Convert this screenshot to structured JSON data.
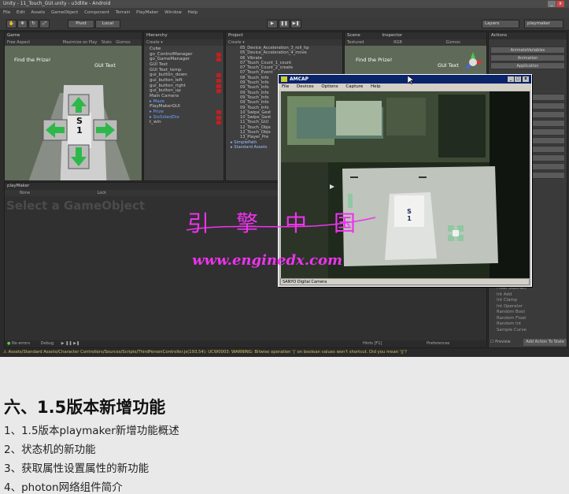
{
  "unity": {
    "window_title": "Unity - 11_Touch_GUI.unity - u3dlite - Android",
    "menu": [
      "File",
      "Edit",
      "Assets",
      "GameObject",
      "Component",
      "Terrain",
      "PlayMaker",
      "Window",
      "Help"
    ],
    "toolbar": {
      "pivot": "Pivot",
      "local": "Local",
      "layers": "Layers",
      "layout": "playmaker"
    },
    "game_tab": {
      "label": "Game",
      "aspect": "Free Aspect",
      "maximize": "Maximize on Play",
      "stats": "Stats",
      "gizmos": "Gizmos"
    },
    "game_view": {
      "find_prize": "Find the Prize!",
      "gui_text": "GUI Text",
      "score_label": "S",
      "score_value": "1"
    },
    "hierarchy": {
      "tab": "Hierarchy",
      "create": "Create",
      "items": [
        "Cube",
        "go_ControlManager",
        "go_GameManager",
        "GUI Text",
        "GUI Text_temp",
        "gui_button_down",
        "gui_button_left",
        "gui_button_right",
        "gui_button_up",
        "Main Camera",
        "Maze",
        "PlayMakerGUI",
        "Prize",
        "SixSidedDie",
        "t_win"
      ]
    },
    "project": {
      "tab": "Project",
      "create": "Create",
      "items": [
        "05_Device_Acceleration_3_roll_hp",
        "05_Device_Acceleration_4_move",
        "06_Vibrate",
        "07_Touch_Count_1_count",
        "07_Touch_Count_2_create",
        "07_Touch_Event",
        "08_Touch_Info",
        "09_Touch_Info",
        "09_Touch_Info",
        "09_Touch_Info",
        "09_Touch_Info",
        "09_Touch_Info",
        "09_Touch_Info",
        "10_Swipe_Gest",
        "10_Swipe_Gest",
        "11_Touch_GUI",
        "12_Touch_Obje",
        "12_Touch_Obje",
        "13_Player_Pre"
      ],
      "folders": [
        "SimplePath",
        "Standard Assets"
      ]
    },
    "scene_tab": {
      "label": "Scene",
      "shading": "Textured",
      "rgb": "RGB",
      "gizmos": "Gizmos"
    },
    "scene_view": {
      "find_prize": "Find the Prize!",
      "gui_text": "GUI Text"
    },
    "inspector_tab": "Inspector",
    "actions": {
      "tab": "Actions",
      "buttons": [
        "AnimateVariables",
        "Animation",
        "Application"
      ],
      "list": [
        "Float Subtract",
        "Int Add",
        "Int Clamp",
        "Int Operator",
        "Random Bool",
        "Random Float",
        "Random Int",
        "Sample Curve"
      ],
      "preview": "Preview",
      "add_to_state": "Add Action To State"
    },
    "playmaker": {
      "tab": "playMaker",
      "none": "None",
      "lock": "Lock",
      "select_prompt": "Select a GameObject",
      "no_errors": "No errors",
      "debug": "Debug",
      "hints": "Hints [F1]",
      "preferences": "Preferences"
    },
    "status_message": "Assets/Standard Assets/Character Controllers/Sources/Scripts/ThirdPersonController.js(193,54): UCW0003: WARNING: Bitwise operation '|' on boolean values won't shortcut. Did you mean '||'?"
  },
  "amcap": {
    "title": "AMCAP",
    "menu": [
      "File",
      "Devices",
      "Options",
      "Capture",
      "Help"
    ],
    "status": "SANYO Digital Camera",
    "score_label": "S",
    "score_value": "1"
  },
  "watermark": {
    "chinese": "引擎中国",
    "url": "www.enginedx.com"
  },
  "document": {
    "heading": "六、1.5版本新增功能",
    "items": [
      "1、1.5版本playmaker新增功能概述",
      "2、状态机的新功能",
      "3、获取属性设置属性的新功能",
      "4、photon网络组件简介"
    ]
  }
}
